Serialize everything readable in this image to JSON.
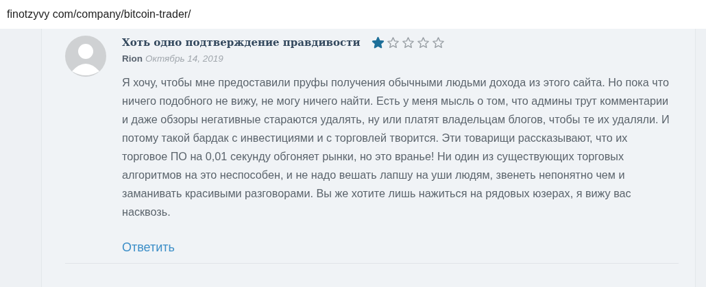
{
  "address_bar": {
    "url": "finotzyvy com/company/bitcoin-trader/"
  },
  "comment": {
    "title": "Хоть одно подтверждение правдивости",
    "stars": 1,
    "author": "Rion",
    "date": "Октябрь 14, 2019",
    "text": "Я хочу, чтобы мне предоставили пруфы получения обычными людьми дохода из этого сайта. Но пока что ничего подобного не вижу, не могу ничего найти. Есть у меня мысль о том, что админы трут комментарии и даже обзоры негативные стараются удалять, ну или платят владельцам блогов, чтобы те их удаляли. И потому такой бардак с инвестициями и с торговлей творится. Эти товарищи рассказывают, что их торговое ПО на 0,01 секунду обгоняет рынки, но это вранье! Ни один из существующих торговых алгоритмов на это неспособен, и не надо вешать лапшу на уши людям, звенеть непонятно чем и заманивать красивыми разговорами. Вы же хотите лишь нажиться на рядовых юзерах, я вижу вас насквозь.",
    "reply": "Ответить"
  }
}
